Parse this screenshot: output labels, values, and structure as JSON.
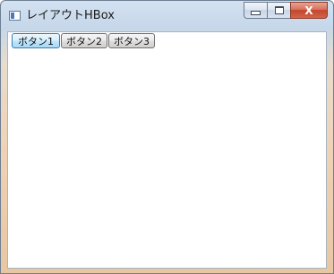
{
  "window": {
    "title": "レイアウトHBox",
    "caption": {
      "close_glyph": "X"
    }
  },
  "hbox": {
    "buttons": [
      "ボタン1",
      "ボタン2",
      "ボタン3"
    ]
  }
}
